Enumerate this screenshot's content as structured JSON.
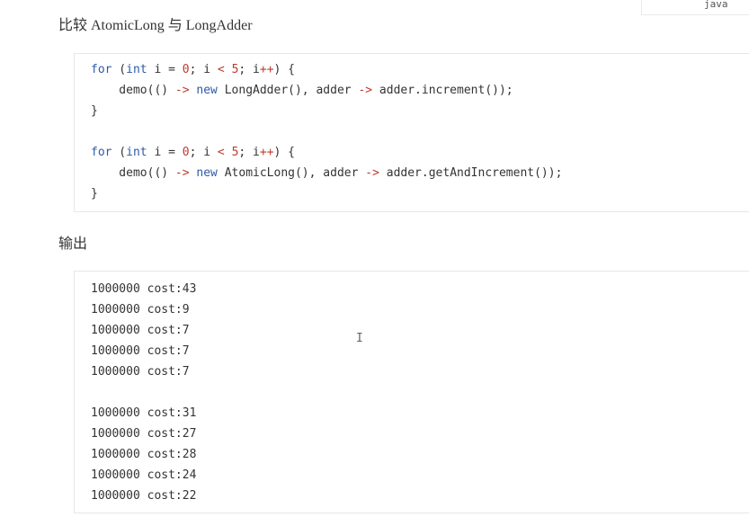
{
  "lang_tag": "java",
  "heading_compare": "比较 AtomicLong 与 LongAdder",
  "heading_output": "输出",
  "code_lines": [
    [
      {
        "t": "for",
        "c": "kw"
      },
      {
        "t": " ("
      },
      {
        "t": "int",
        "c": "kw"
      },
      {
        "t": " i = "
      },
      {
        "t": "0",
        "c": "op"
      },
      {
        "t": "; i "
      },
      {
        "t": "<",
        "c": "op"
      },
      {
        "t": " "
      },
      {
        "t": "5",
        "c": "op"
      },
      {
        "t": "; i"
      },
      {
        "t": "++",
        "c": "op"
      },
      {
        "t": ") {"
      }
    ],
    [
      {
        "t": "    demo(() "
      },
      {
        "t": "->",
        "c": "op"
      },
      {
        "t": " "
      },
      {
        "t": "new",
        "c": "kw"
      },
      {
        "t": " LongAdder(), adder "
      },
      {
        "t": "->",
        "c": "op"
      },
      {
        "t": " adder.increment());"
      }
    ],
    [
      {
        "t": "}"
      }
    ],
    [
      {
        "t": ""
      }
    ],
    [
      {
        "t": "for",
        "c": "kw"
      },
      {
        "t": " ("
      },
      {
        "t": "int",
        "c": "kw"
      },
      {
        "t": " i = "
      },
      {
        "t": "0",
        "c": "op"
      },
      {
        "t": "; i "
      },
      {
        "t": "<",
        "c": "op"
      },
      {
        "t": " "
      },
      {
        "t": "5",
        "c": "op"
      },
      {
        "t": "; i"
      },
      {
        "t": "++",
        "c": "op"
      },
      {
        "t": ") {"
      }
    ],
    [
      {
        "t": "    demo(() "
      },
      {
        "t": "->",
        "c": "op"
      },
      {
        "t": " "
      },
      {
        "t": "new",
        "c": "kw"
      },
      {
        "t": " AtomicLong(), adder "
      },
      {
        "t": "->",
        "c": "op"
      },
      {
        "t": " adder.getAndIncrement());"
      }
    ],
    [
      {
        "t": "}"
      }
    ]
  ],
  "output_lines": [
    "1000000 cost:43",
    "1000000 cost:9",
    "1000000 cost:7",
    "1000000 cost:7",
    "1000000 cost:7",
    "",
    "1000000 cost:31",
    "1000000 cost:27",
    "1000000 cost:28",
    "1000000 cost:24",
    "1000000 cost:22"
  ],
  "cursor_glyph": "I"
}
